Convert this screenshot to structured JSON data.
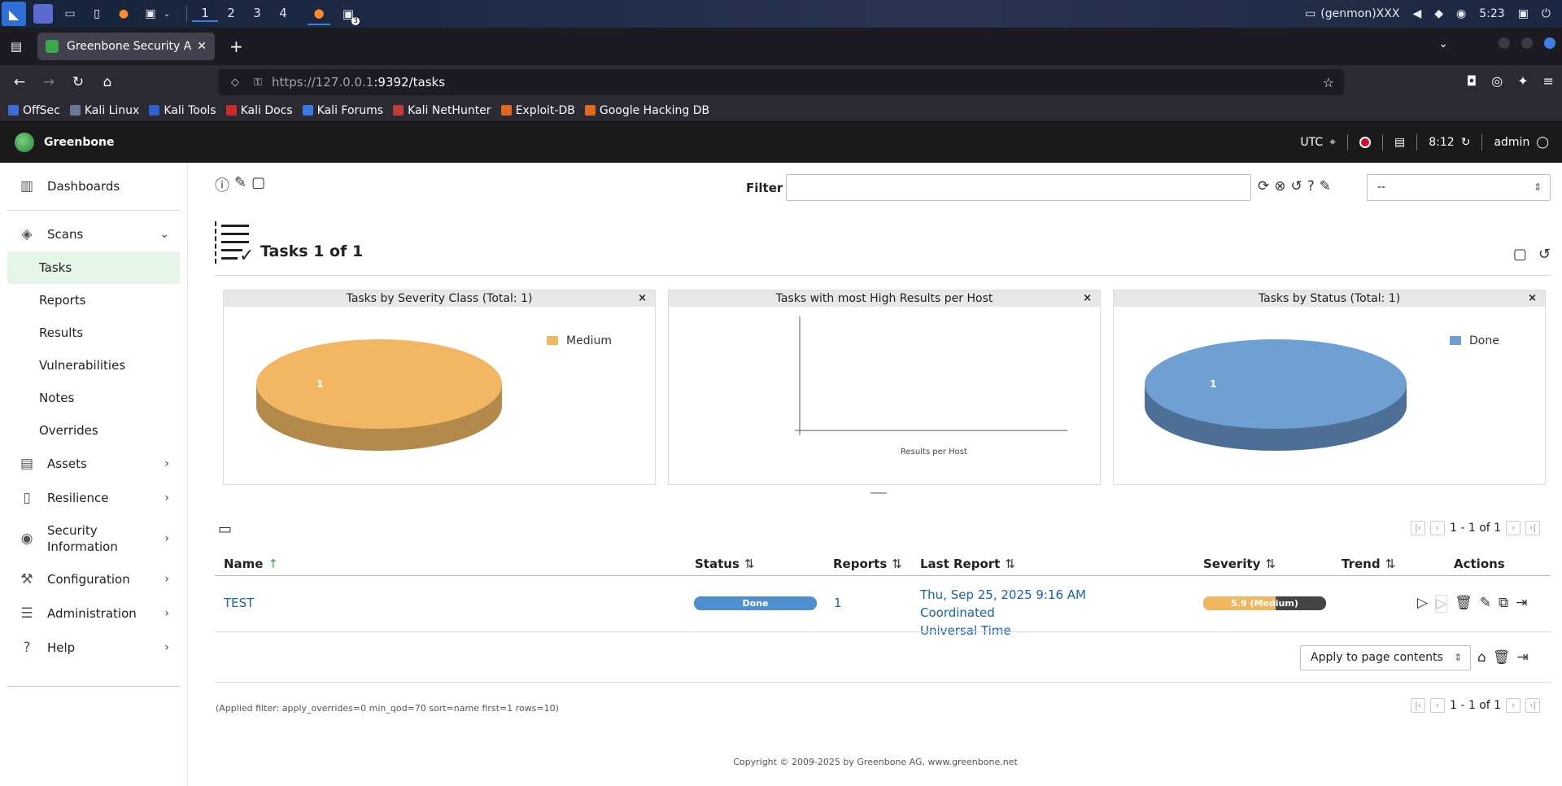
{
  "os_panel": {
    "workspaces": [
      "1",
      "2",
      "3",
      "4"
    ],
    "active_workspace": "1",
    "terminal_badge": "3",
    "genmon": "(genmon)XXX",
    "clock": "5:23"
  },
  "browser": {
    "tab_title": "Greenbone Security Assistant",
    "url_host": "https://127.0.0.1",
    "url_rest": ":9392/tasks",
    "bookmarks": [
      "OffSec",
      "Kali Linux",
      "Kali Tools",
      "Kali Docs",
      "Kali Forums",
      "Kali NetHunter",
      "Exploit-DB",
      "Google Hacking DB"
    ]
  },
  "gsa_header": {
    "brand": "Greenbone",
    "timezone": "UTC",
    "time": "8:12",
    "user": "admin"
  },
  "sidebar": {
    "dashboards": "Dashboards",
    "scans": "Scans",
    "scan_items": [
      "Tasks",
      "Reports",
      "Results",
      "Vulnerabilities",
      "Notes",
      "Overrides"
    ],
    "active_item": "Tasks",
    "assets": "Assets",
    "resilience": "Resilience",
    "security_info_line1": "Security",
    "security_info_line2": "Information",
    "configuration": "Configuration",
    "administration": "Administration",
    "help": "Help"
  },
  "filter": {
    "label": "Filter",
    "value": "",
    "select_value": "--"
  },
  "page": {
    "title": "Tasks 1 of 1"
  },
  "charts": [
    {
      "title": "Tasks by Severity Class (Total: 1)",
      "close": "×",
      "legend": "Medium",
      "slice_label": "1",
      "color": "#f2b763"
    },
    {
      "title": "Tasks with most High Results per Host",
      "close": "×",
      "xlabel": "Results per Host"
    },
    {
      "title": "Tasks by Status (Total: 1)",
      "close": "×",
      "legend": "Done",
      "slice_label": "1",
      "color": "#6f9fd3"
    }
  ],
  "chart_data": [
    {
      "type": "pie",
      "title": "Tasks by Severity Class (Total: 1)",
      "categories": [
        "Medium"
      ],
      "values": [
        1
      ],
      "legend": "top-right"
    },
    {
      "type": "bar",
      "title": "Tasks with most High Results per Host",
      "categories": [],
      "values": [],
      "xlabel": "Results per Host"
    },
    {
      "type": "pie",
      "title": "Tasks by Status (Total: 1)",
      "categories": [
        "Done"
      ],
      "values": [
        1
      ],
      "legend": "top-right"
    }
  ],
  "pagination": {
    "text": "1 - 1 of 1"
  },
  "table": {
    "columns": {
      "name": "Name",
      "status": "Status",
      "reports": "Reports",
      "last_report": "Last Report",
      "severity": "Severity",
      "trend": "Trend",
      "actions": "Actions"
    },
    "rows": [
      {
        "name": "TEST",
        "status": "Done",
        "status_progress": 1.0,
        "reports": "1",
        "last_report_line1": "Thu, Sep 25, 2025 9:16 AM Coordinated",
        "last_report_line2": "Universal Time",
        "severity": "5.9 (Medium)",
        "severity_value": 5.9,
        "trend": ""
      }
    ]
  },
  "bulk": {
    "select_value": "Apply to page contents"
  },
  "footer": {
    "applied_filter": "(Applied filter: apply_overrides=0 min_qod=70 sort=name first=1 rows=10)",
    "copyright": "Copyright © 2009-2025 by Greenbone AG, www.greenbone.net"
  },
  "colors": {
    "accent_green": "#39a34d",
    "link_blue": "#1a5fb4",
    "done_blue": "#4f8ecf",
    "medium_orange": "#f0b760"
  }
}
